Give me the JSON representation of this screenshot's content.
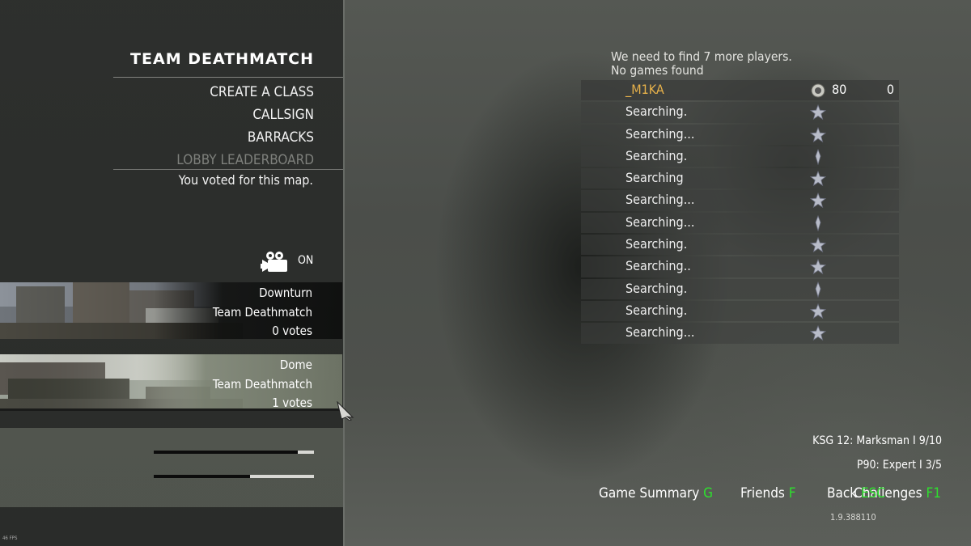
{
  "menu": {
    "title": "TEAM DEATHMATCH",
    "items": [
      {
        "label": "CREATE A CLASS",
        "enabled": true
      },
      {
        "label": "CALLSIGN",
        "enabled": true
      },
      {
        "label": "BARRACKS",
        "enabled": true
      },
      {
        "label": "LOBBY LEADERBOARD",
        "enabled": false
      }
    ],
    "vote_note": "You voted for this map."
  },
  "camera": {
    "icon": "movie-camera-icon",
    "status": "ON"
  },
  "maps": [
    {
      "name": "Downturn",
      "mode": "Team Deathmatch",
      "votes": "0 votes"
    },
    {
      "name": "Dome",
      "mode": "Team Deathmatch",
      "votes": "1 votes"
    }
  ],
  "challenges": {
    "items": [
      {
        "label": "KSG 12: Marksman I  9/10",
        "progress": 0.9
      },
      {
        "label": "P90: Expert I  3/5",
        "progress": 0.6
      }
    ],
    "button_label": "Challenges",
    "button_key": "F1"
  },
  "lobby": {
    "status_line1": "We need to find 7 more players.",
    "status_line2": "No games found",
    "players": [
      {
        "name": "_M1KA",
        "level": "80",
        "score": "0",
        "is_me": true
      },
      {
        "name": "Searching.",
        "level": "",
        "score": ""
      },
      {
        "name": "Searching...",
        "level": "",
        "score": ""
      },
      {
        "name": "Searching.",
        "level": "",
        "score": ""
      },
      {
        "name": "Searching",
        "level": "",
        "score": ""
      },
      {
        "name": "Searching...",
        "level": "",
        "score": ""
      },
      {
        "name": "Searching...",
        "level": "",
        "score": ""
      },
      {
        "name": "Searching.",
        "level": "",
        "score": ""
      },
      {
        "name": "Searching..",
        "level": "",
        "score": ""
      },
      {
        "name": "Searching.",
        "level": "",
        "score": ""
      },
      {
        "name": "Searching.",
        "level": "",
        "score": ""
      },
      {
        "name": "Searching...",
        "level": "",
        "score": ""
      }
    ]
  },
  "footer": {
    "game_summary": {
      "label": "Game Summary",
      "key": "G"
    },
    "friends": {
      "label": "Friends",
      "key": "F"
    },
    "back": {
      "label": "Back",
      "key": "ESC"
    }
  },
  "version": "1.9.388110",
  "fps": "46 FPS",
  "colors": {
    "accent_key": "#2ee02e",
    "player_name": "#e8b24a"
  }
}
